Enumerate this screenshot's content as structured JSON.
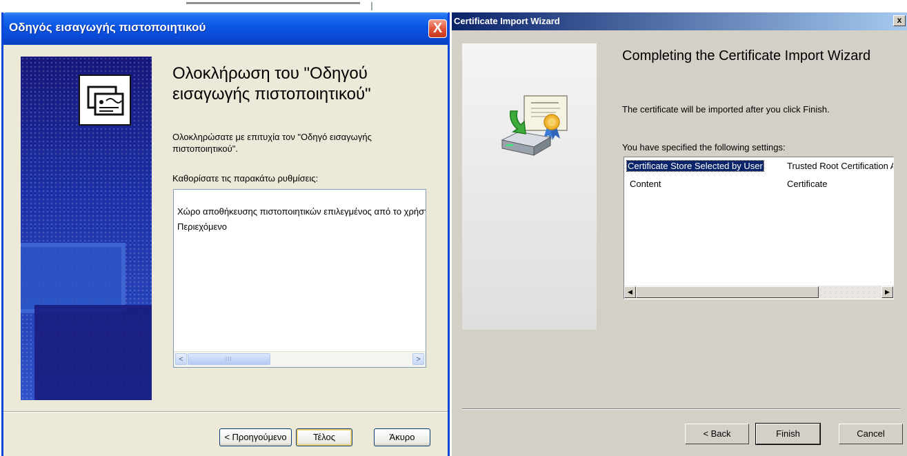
{
  "greek_dialog": {
    "title": "Οδηγός εισαγωγής πιστοποιητικού",
    "close_label": "X",
    "heading": "Ολοκλήρωση του \"Οδηγού εισαγωγής πιστοποιητικού\"",
    "success_text": "Ολοκληρώσατε με επιτυχία τον \"Οδηγό εισαγωγής πιστοποιητικού\".",
    "settings_label": "Καθορίσατε τις παρακάτω ρυθμίσεις:",
    "settings_rows": [
      "Χώρο αποθήκευσης πιστοποιητικών επιλεγμένος από το χρήστη",
      "Περιεχόμενο"
    ],
    "scroll_left": "<",
    "scroll_right": ">",
    "scroll_grip": "III",
    "buttons": {
      "back": "< Προηγούμενο",
      "finish": "Τέλος",
      "cancel": "Άκυρο"
    }
  },
  "english_dialog": {
    "title": "Certificate Import Wizard",
    "close_label": "x",
    "heading": "Completing the Certificate Import Wizard",
    "info_text": "The certificate will be imported after you click Finish.",
    "settings_label": "You have specified the following settings:",
    "settings_table": [
      {
        "setting": "Certificate Store Selected by User",
        "value": "Trusted Root Certification Authorities"
      },
      {
        "setting": "Content",
        "value": "Certificate"
      }
    ],
    "scroll_left": "◀",
    "scroll_right": "▶",
    "buttons": {
      "back": "< Back",
      "finish": "Finish",
      "cancel": "Cancel"
    }
  },
  "colors": {
    "xp_title_blue": "#0a4ad6",
    "xp_face": "#ece9d8",
    "classic_face": "#d4d0c8",
    "classic_title": "#0a246a",
    "selection": "#0a246a"
  },
  "icons": {
    "greek_banner": "certificate-cards-icon",
    "english_side": "certificate-install-icon"
  }
}
